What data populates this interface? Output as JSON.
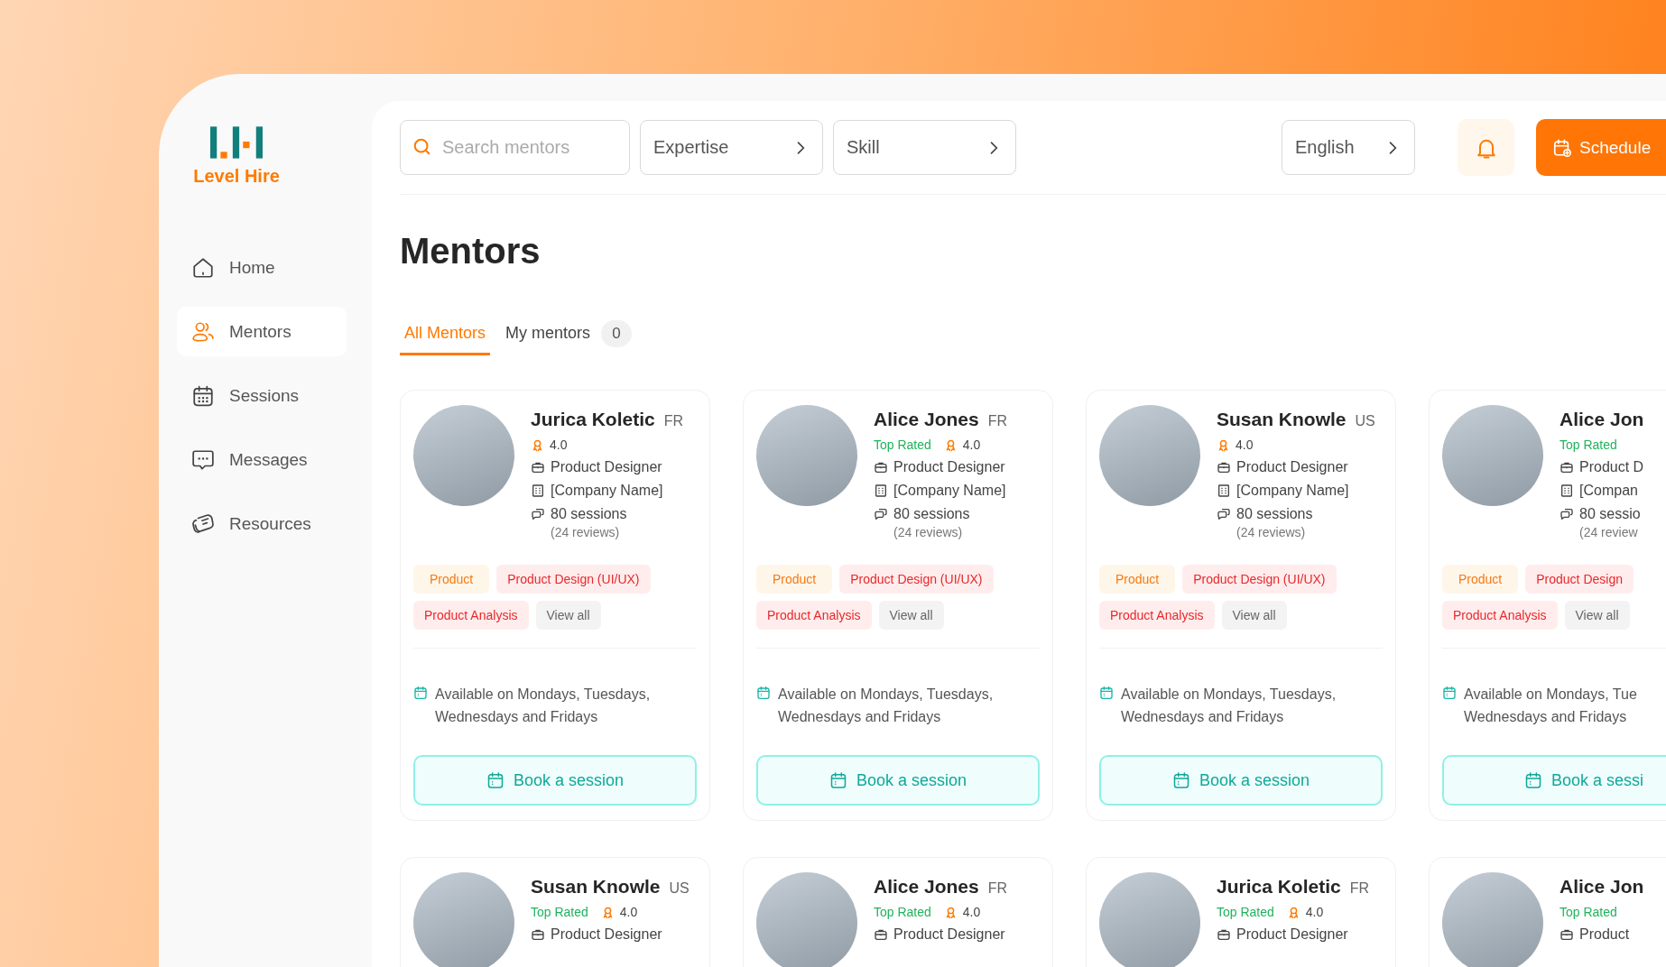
{
  "brand": {
    "name": "Level Hire"
  },
  "nav": [
    {
      "label": "Home",
      "kind": "home",
      "selected": false
    },
    {
      "label": "Mentors",
      "kind": "people",
      "selected": true
    },
    {
      "label": "Sessions",
      "kind": "calendar",
      "selected": false
    },
    {
      "label": "Messages",
      "kind": "chat",
      "selected": false
    },
    {
      "label": "Resources",
      "kind": "resources",
      "selected": false
    }
  ],
  "toolbar": {
    "search": {
      "placeholder": "Search mentors"
    },
    "filters": [
      {
        "label": "Expertise"
      },
      {
        "label": "Skill"
      }
    ],
    "language": "English",
    "schedule_button": "Schedule"
  },
  "page_title": "Mentors",
  "tabs": [
    {
      "label": "All Mentors",
      "selected": true
    },
    {
      "label": "My mentors",
      "selected": false,
      "count": "0"
    }
  ],
  "mentors": [
    {
      "name": "Jurica Koletic",
      "country": "FR",
      "rating": "4.0",
      "role": "Product Designer",
      "company": "[Company Name]",
      "sessions": "80 sessions",
      "reviews": "(24 reviews)",
      "tags": [
        {
          "label": "Product",
          "kind": "category"
        },
        {
          "label": "Product Design (UI/UX)",
          "kind": "skill"
        },
        {
          "label": "Product Analysis",
          "kind": "skill"
        },
        {
          "label": "View all",
          "kind": "more"
        }
      ],
      "availability": [
        "Available on Mondays, Tuesdays,",
        "Wednesdays and Fridays"
      ],
      "book_label": "Book a session"
    },
    {
      "name": "Alice Jones",
      "country": "FR",
      "badge": "Top Rated",
      "rating": "4.0",
      "role": "Product Designer",
      "company": "[Company Name]",
      "sessions": "80 sessions",
      "reviews": "(24 reviews)",
      "tags": [
        {
          "label": "Product",
          "kind": "category"
        },
        {
          "label": "Product Design (UI/UX)",
          "kind": "skill"
        },
        {
          "label": "Product Analysis",
          "kind": "skill"
        },
        {
          "label": "View all",
          "kind": "more"
        }
      ],
      "availability": [
        "Available on Mondays, Tuesdays,",
        "Wednesdays and Fridays"
      ],
      "book_label": "Book a session"
    },
    {
      "name": "Susan Knowle",
      "country": "US",
      "rating": "4.0",
      "role": "Product Designer",
      "company": "[Company Name]",
      "sessions": "80 sessions",
      "reviews": "(24 reviews)",
      "tags": [
        {
          "label": "Product",
          "kind": "category"
        },
        {
          "label": "Product Design (UI/UX)",
          "kind": "skill"
        },
        {
          "label": "Product Analysis",
          "kind": "skill"
        },
        {
          "label": "View all",
          "kind": "more"
        }
      ],
      "availability": [
        "Available on Mondays, Tuesdays,",
        "Wednesdays and Fridays"
      ],
      "book_label": "Book a session"
    },
    {
      "name": "Alice Jon",
      "badge": "Top Rated",
      "role": "Product D",
      "company": "[Compan",
      "sessions": "80 sessio",
      "reviews": "(24 review",
      "tags": [
        {
          "label": "Product",
          "kind": "category"
        },
        {
          "label": "Product Design",
          "kind": "skill"
        },
        {
          "label": "Product Analysis",
          "kind": "skill"
        },
        {
          "label": "View all",
          "kind": "more"
        }
      ],
      "availability": [
        "Available on Mondays, Tue",
        "Wednesdays and Fridays"
      ],
      "book_label": "Book a sessi"
    },
    {
      "name": "Susan Knowle",
      "country": "US",
      "badge": "Top Rated",
      "rating": "4.0",
      "role": "Product Designer"
    },
    {
      "name": "Alice Jones",
      "country": "FR",
      "badge": "Top Rated",
      "rating": "4.0",
      "role": "Product Designer"
    },
    {
      "name": "Jurica Koletic",
      "country": "FR",
      "badge": "Top Rated",
      "rating": "4.0",
      "role": "Product Designer"
    },
    {
      "name": "Alice Jon",
      "badge": "Top Rated",
      "role": "Product"
    }
  ]
}
